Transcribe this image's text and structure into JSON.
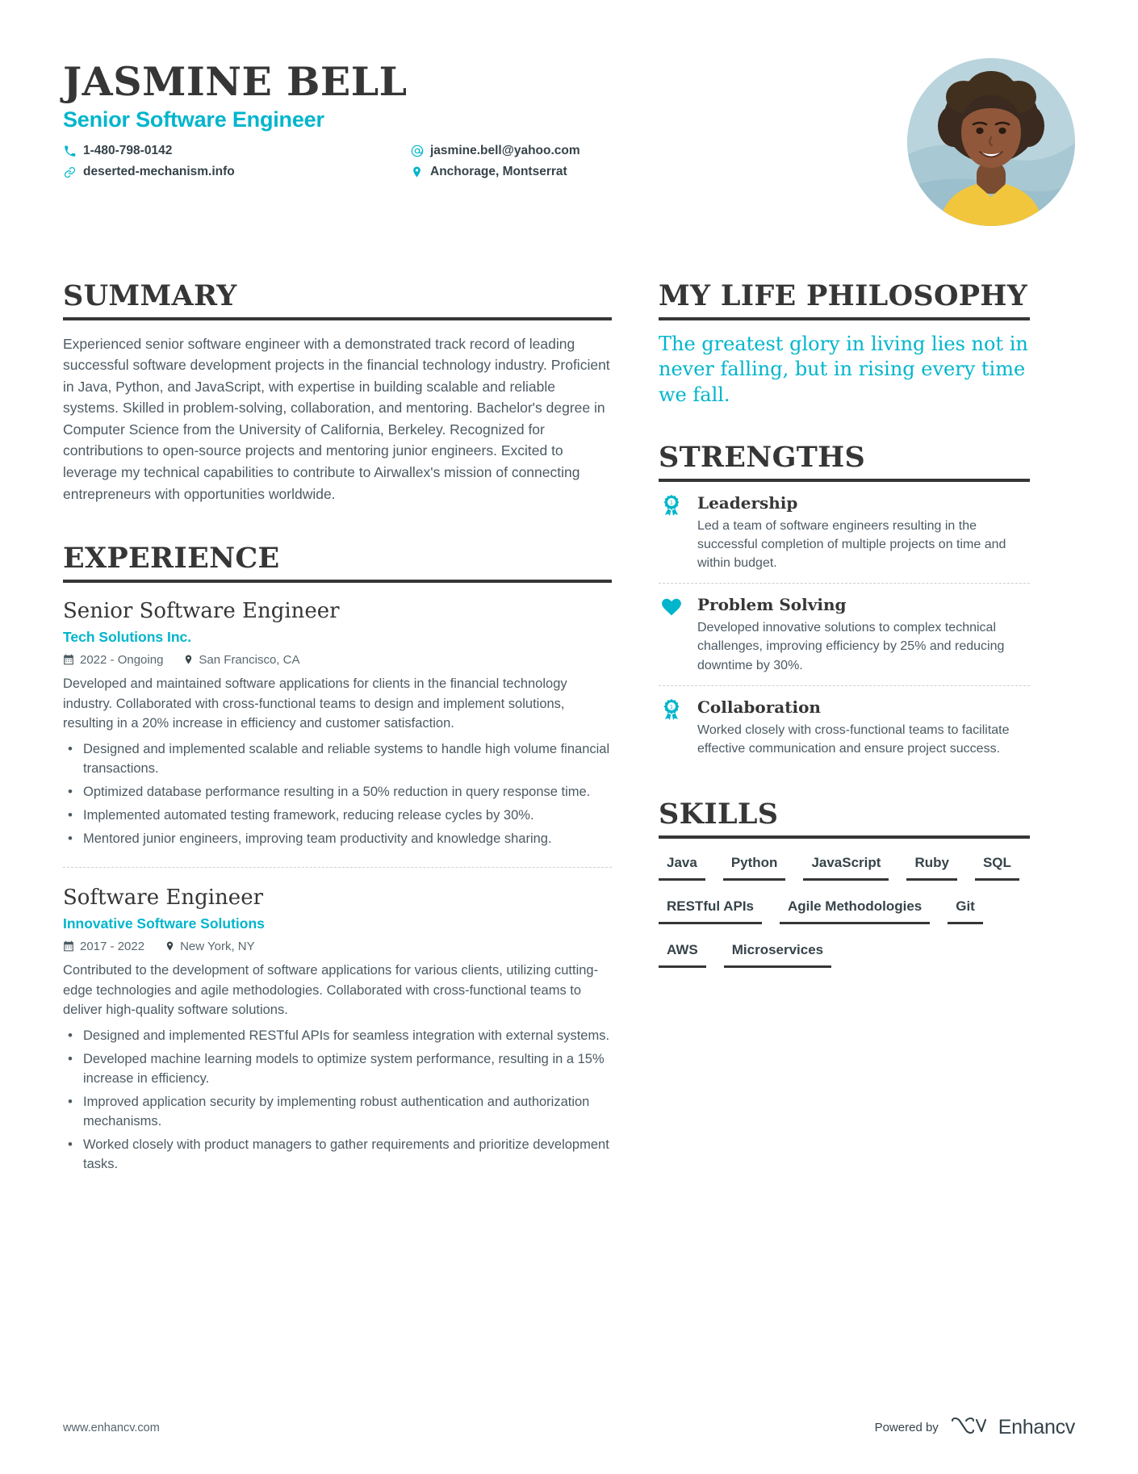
{
  "header": {
    "name": "JASMINE BELL",
    "job_title": "Senior Software Engineer",
    "contacts": [
      {
        "icon": "phone-icon",
        "text": "1-480-798-0142"
      },
      {
        "icon": "email-icon",
        "text": "jasmine.bell@yahoo.com"
      },
      {
        "icon": "link-icon",
        "text": "deserted-mechanism.info"
      },
      {
        "icon": "location-pin-icon",
        "text": "Anchorage, Montserrat"
      }
    ]
  },
  "summary": {
    "heading": "SUMMARY",
    "text": "Experienced senior software engineer with a demonstrated track record of leading successful software development projects in the financial technology industry. Proficient in Java, Python, and JavaScript, with expertise in building scalable and reliable systems. Skilled in problem-solving, collaboration, and mentoring. Bachelor's degree in Computer Science from the University of California, Berkeley. Recognized for contributions to open-source projects and mentoring junior engineers. Excited to leverage my technical capabilities to contribute to Airwallex's mission of connecting entrepreneurs with opportunities worldwide."
  },
  "experience": {
    "heading": "EXPERIENCE",
    "items": [
      {
        "role": "Senior Software Engineer",
        "company": "Tech Solutions Inc.",
        "dates": "2022 - Ongoing",
        "location": "San Francisco, CA",
        "description": "Developed and maintained software applications for clients in the financial technology industry. Collaborated with cross-functional teams to design and implement solutions, resulting in a 20% increase in efficiency and customer satisfaction.",
        "bullets": [
          "Designed and implemented scalable and reliable systems to handle high volume financial transactions.",
          "Optimized database performance resulting in a 50% reduction in query response time.",
          "Implemented automated testing framework, reducing release cycles by 30%.",
          "Mentored junior engineers, improving team productivity and knowledge sharing."
        ]
      },
      {
        "role": "Software Engineer",
        "company": "Innovative Software Solutions",
        "dates": "2017 - 2022",
        "location": "New York, NY",
        "description": "Contributed to the development of software applications for various clients, utilizing cutting-edge technologies and agile methodologies. Collaborated with cross-functional teams to deliver high-quality software solutions.",
        "bullets": [
          "Designed and implemented RESTful APIs for seamless integration with external systems.",
          "Developed machine learning models to optimize system performance, resulting in a 15% increase in efficiency.",
          "Improved application security by implementing robust authentication and authorization mechanisms.",
          "Worked closely with product managers to gather requirements and prioritize development tasks."
        ]
      }
    ]
  },
  "philosophy": {
    "heading": "MY LIFE PHILOSOPHY",
    "quote": "The greatest glory in living lies not in never falling, but in rising every time we fall."
  },
  "strengths": {
    "heading": "STRENGTHS",
    "items": [
      {
        "icon": "award-ribbon-icon",
        "title": "Leadership",
        "description": "Led a team of software engineers resulting in the successful completion of multiple projects on time and within budget."
      },
      {
        "icon": "heart-icon",
        "title": "Problem Solving",
        "description": "Developed innovative solutions to complex technical challenges, improving efficiency by 25% and reducing downtime by 30%."
      },
      {
        "icon": "award-ribbon-icon",
        "title": "Collaboration",
        "description": "Worked closely with cross-functional teams to facilitate effective communication and ensure project success."
      }
    ]
  },
  "skills": {
    "heading": "SKILLS",
    "items": [
      "Java",
      "Python",
      "JavaScript",
      "Ruby",
      "SQL",
      "RESTful APIs",
      "Agile Methodologies",
      "Git",
      "AWS",
      "Microservices"
    ]
  },
  "footer": {
    "url": "www.enhancv.com",
    "powered_by": "Powered by",
    "brand": "Enhancv"
  },
  "colors": {
    "accent": "#00b5cc",
    "heading": "#363636",
    "body_text": "#4c5a63"
  }
}
